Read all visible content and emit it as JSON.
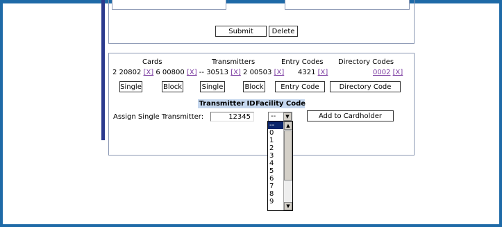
{
  "form_actions": {
    "submit_label": "Submit",
    "delete_label": "Delete"
  },
  "cards_panel": {
    "headers": {
      "cards": "Cards",
      "transmitters": "Transmitters",
      "entry_codes": "Entry Codes",
      "directory_codes": "Directory Codes"
    },
    "card_1": "2 20802",
    "card_2": "6 00800",
    "separator": "--",
    "transmitter_1": "30513",
    "transmitter_2": "2 00503",
    "entry_code": "4321",
    "directory_code": "0002",
    "remove_label": "[X]",
    "buttons": {
      "cards_single": "Single",
      "cards_block": "Block",
      "transmitters_single": "Single",
      "transmitters_block": "Block",
      "entry_code": "Entry Code",
      "directory_code": "Directory Code"
    }
  },
  "assign": {
    "col_transmitter_id": "Transmitter ID",
    "col_facility_code": "Facility Code",
    "label": "Assign Single Transmitter:",
    "transmitter_id_value": "12345",
    "facility_code_value": "--",
    "add_button_label": "Add to Cardholder"
  },
  "facility_dropdown": {
    "options": [
      "--",
      "0",
      "1",
      "2",
      "3",
      "4",
      "5",
      "6",
      "7",
      "8",
      "9"
    ],
    "selected_index": 0,
    "scroll_up_glyph": "▲",
    "scroll_down_glyph": "▼",
    "select_arrow_glyph": "▼"
  }
}
